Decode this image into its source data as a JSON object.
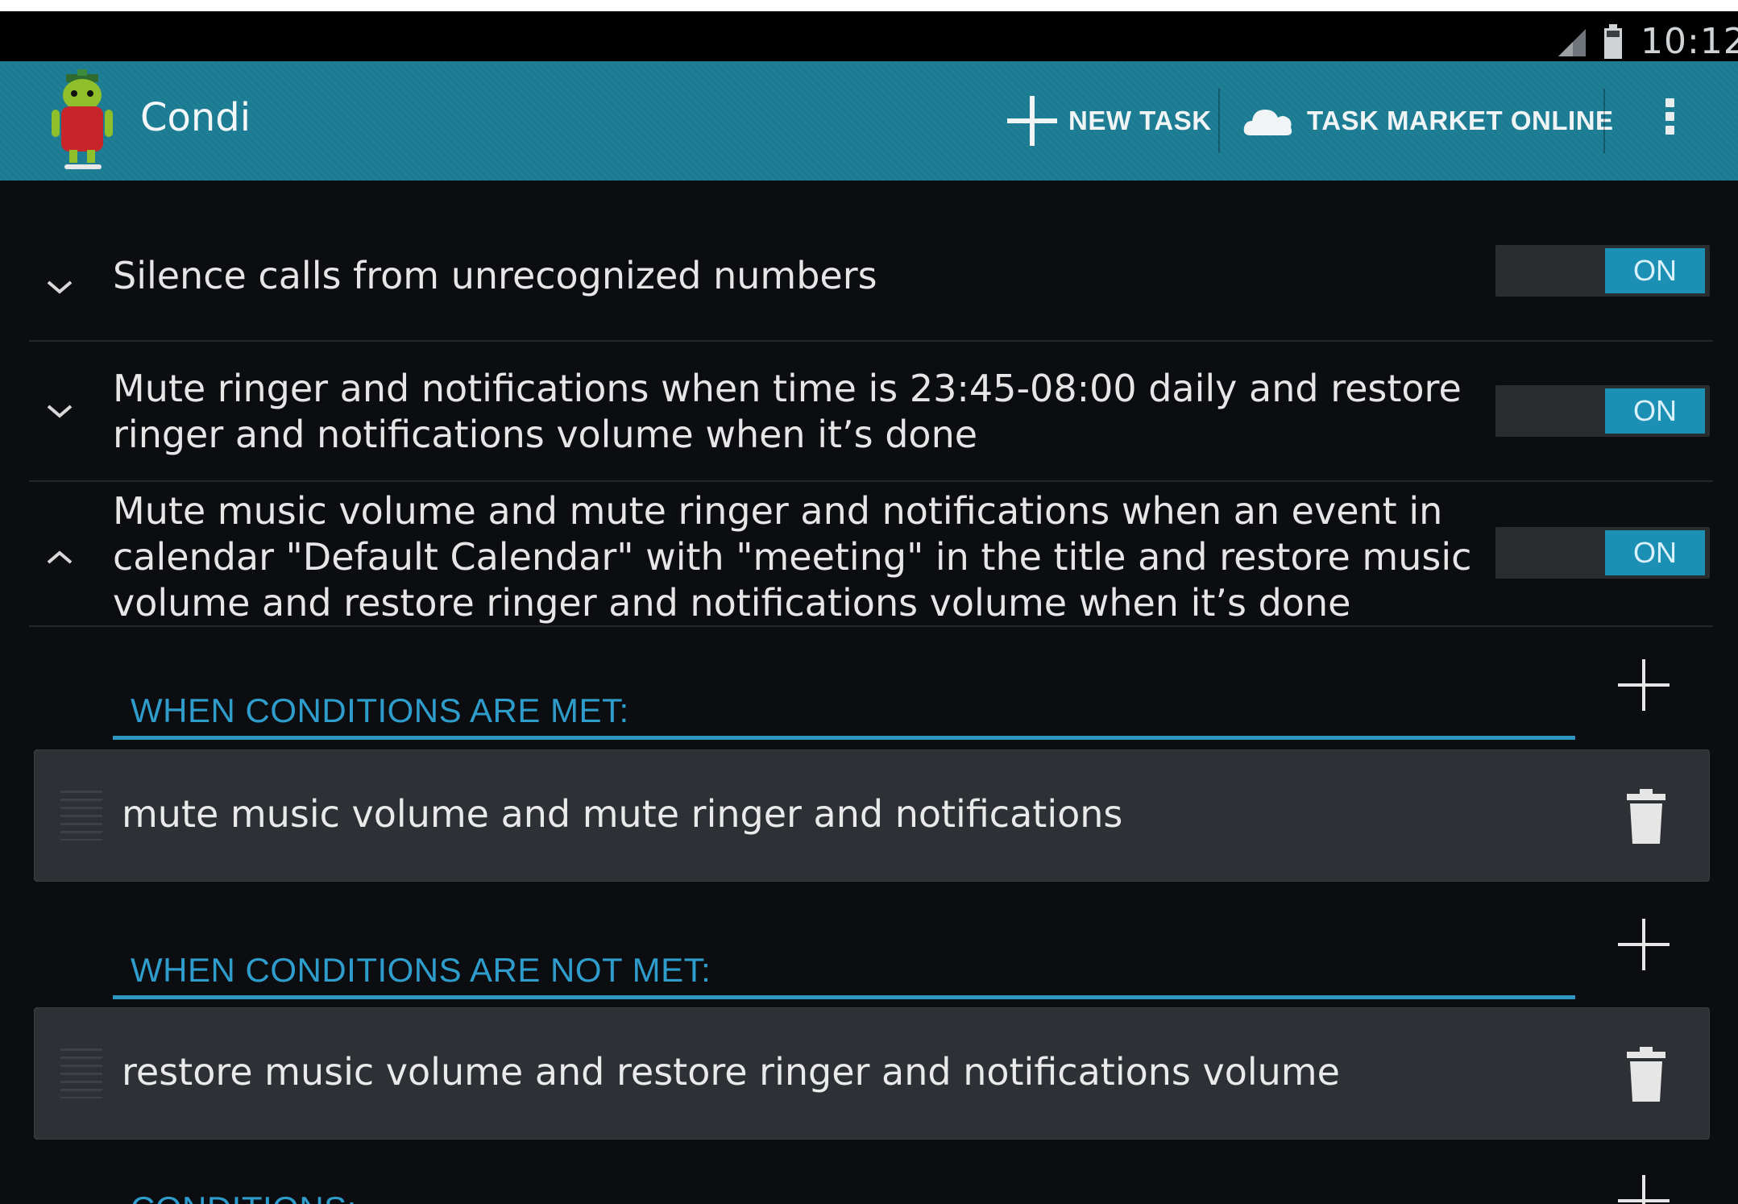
{
  "status_bar": {
    "time": "10:12"
  },
  "action_bar": {
    "app_name": "Condi",
    "new_task_label": "NEW TASK",
    "market_label": "TASK MARKET ONLINE"
  },
  "tasks": [
    {
      "text": "Silence calls from unrecognized numbers",
      "toggle_label": "ON",
      "expanded": false
    },
    {
      "text": "Mute ringer and notifications when time is 23:45-08:00 daily and restore ringer and notifications volume when it’s done",
      "toggle_label": "ON",
      "expanded": false
    },
    {
      "text": "Mute music volume and mute ringer and notifications when an event in calendar \"Default Calendar\" with \"meeting\" in the title and restore music volume and restore ringer and notifications volume when it’s done",
      "toggle_label": "ON",
      "expanded": true
    }
  ],
  "sections": {
    "met": {
      "header": "WHEN CONDITIONS ARE MET:",
      "action": "mute music volume and mute ringer and notifications"
    },
    "not_met": {
      "header": "WHEN CONDITIONS ARE NOT MET:",
      "action": "restore music volume and restore ringer and notifications volume"
    },
    "conditions": {
      "header": "CONDITIONS:"
    }
  },
  "colors": {
    "action_bar": "#1f7f97",
    "accent": "#2f9dcc",
    "toggle_on": "#1c8fb5",
    "card": "#2d3034",
    "background": "#0b0d10"
  },
  "icons": [
    "signal-icon",
    "battery-icon",
    "android-logo-icon",
    "plus-icon",
    "cloud-icon",
    "overflow-menu-icon",
    "chevron-down-icon",
    "chevron-up-icon",
    "drag-handle-icon",
    "trash-icon"
  ]
}
